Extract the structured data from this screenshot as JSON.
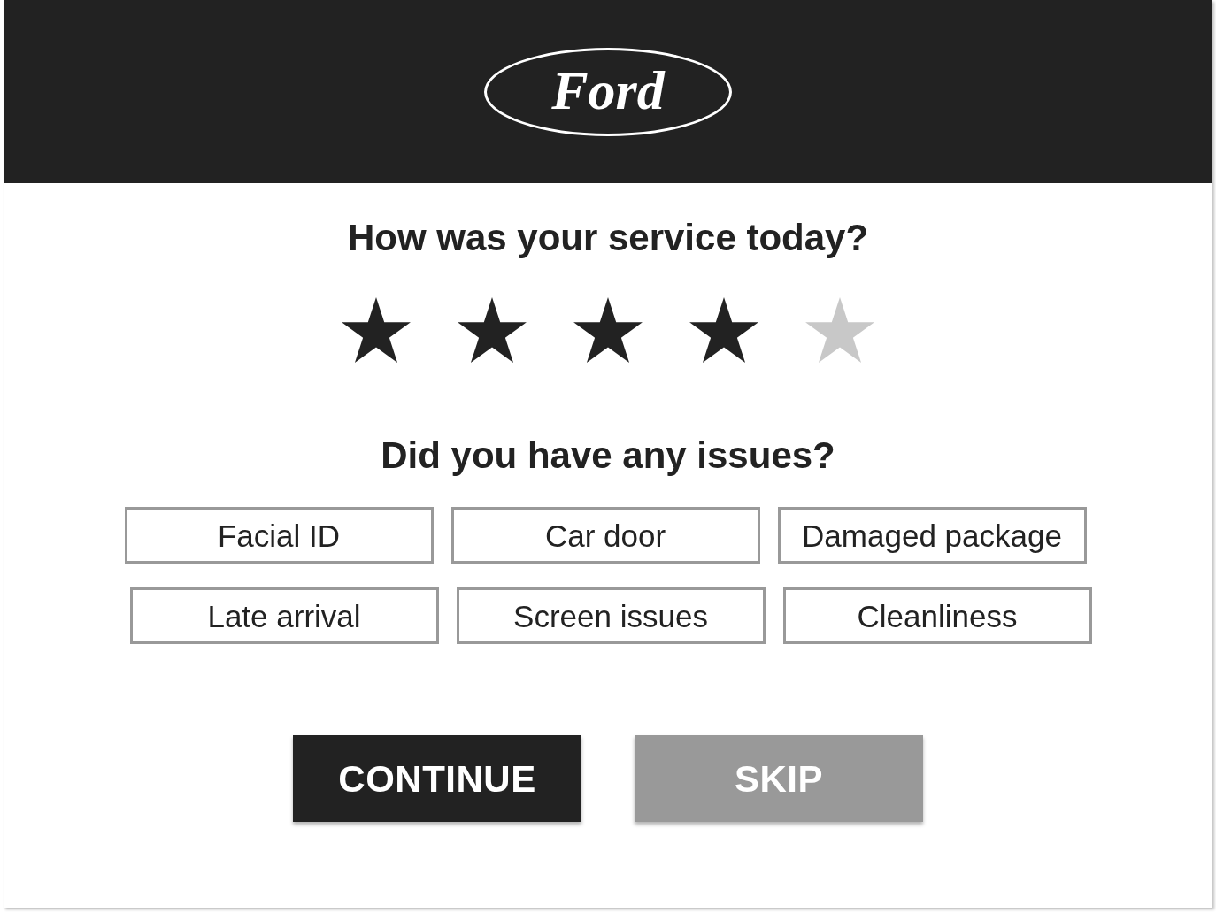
{
  "header": {
    "logo_text": "Ford"
  },
  "rating": {
    "question": "How was your service today?",
    "stars": 4
  },
  "issues": {
    "question": "Did you have any issues?",
    "rows": [
      [
        {
          "label": "Facial ID",
          "selected": false
        },
        {
          "label": "Car door",
          "selected": false
        },
        {
          "label": "Damaged package",
          "selected": false
        }
      ],
      [
        {
          "label": "Late arrival",
          "selected": false
        },
        {
          "label": "Screen issues",
          "selected": false
        },
        {
          "label": "Cleanliness",
          "selected": false
        }
      ]
    ]
  },
  "buttons": [
    {
      "label": "CONTINUE",
      "kind": "primary"
    },
    {
      "label": "SKIP",
      "kind": "secondary"
    }
  ]
}
